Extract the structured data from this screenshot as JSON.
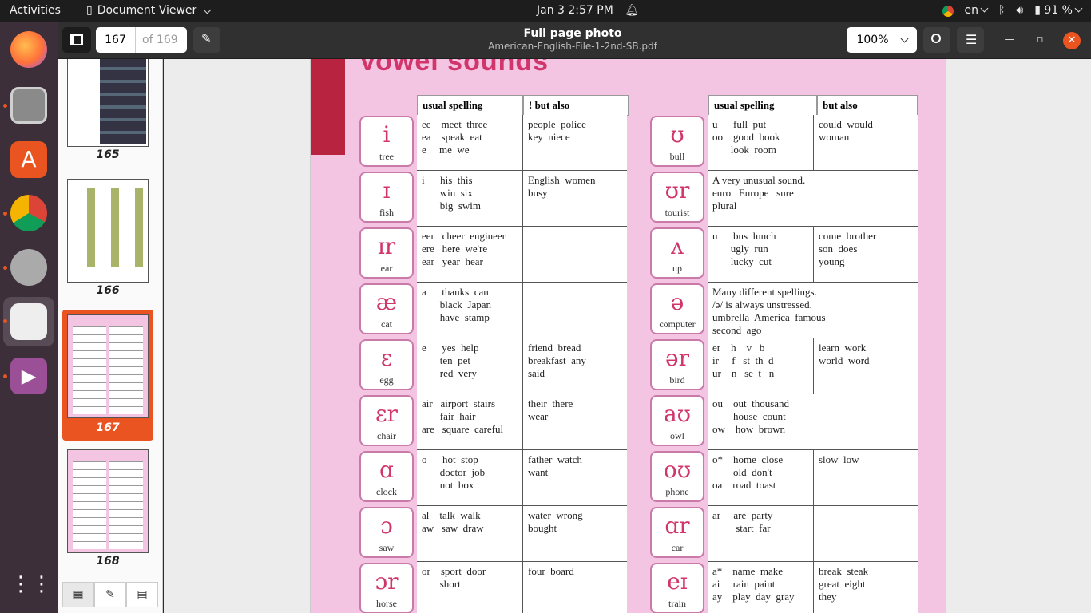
{
  "topbar": {
    "activities": "Activities",
    "app_name": "Document Viewer",
    "datetime": "Jan 3  2:57 PM",
    "lang": "en",
    "battery": "91 %"
  },
  "header": {
    "page_current": "167",
    "page_of": "of 169",
    "title": "Full page photo",
    "subtitle": "American-English-File-1-2nd-SB.pdf",
    "zoom": "100%"
  },
  "sidebar": {
    "thumbs": [
      {
        "label": "165"
      },
      {
        "label": "166"
      },
      {
        "label": "167"
      },
      {
        "label": "168"
      }
    ]
  },
  "page": {
    "heading_fragment": "Vowel sounds",
    "left_headers": {
      "usual": "usual spelling",
      "also": "! but also"
    },
    "right_headers": {
      "usual": "usual spelling",
      "also": "but also"
    },
    "left_rows": [
      {
        "sym": "i",
        "word": "tree",
        "usual": "ee    meet  three\nea    speak  eat\ne     me  we",
        "also": "people  police\nkey  niece"
      },
      {
        "sym": "ɪ",
        "word": "fish",
        "usual": "i      his  this\n       win  six\n       big  swim",
        "also": "English  women\nbusy"
      },
      {
        "sym": "ɪr",
        "word": "ear",
        "usual": "eer   cheer  engineer\nere   here  we're\near   year  hear",
        "also": ""
      },
      {
        "sym": "æ",
        "word": "cat",
        "usual": "a      thanks  can\n       black  Japan\n       have  stamp",
        "also": ""
      },
      {
        "sym": "ɛ",
        "word": "egg",
        "usual": "e      yes  help\n       ten  pet\n       red  very",
        "also": "friend  bread\nbreakfast  any\nsaid"
      },
      {
        "sym": "ɛr",
        "word": "chair",
        "usual": "air   airport  stairs\n       fair  hair\nare   square  careful",
        "also": "their  there\nwear"
      },
      {
        "sym": "ɑ",
        "word": "clock",
        "usual": "o      hot  stop\n       doctor  job\n       not  box",
        "also": "father  watch\nwant"
      },
      {
        "sym": "ɔ",
        "word": "saw",
        "usual": "al    talk  walk\naw   saw  draw",
        "also": "water  wrong\nbought"
      },
      {
        "sym": "ɔr",
        "word": "horse",
        "usual": "or    sport  door\n       short",
        "also": "four  board"
      }
    ],
    "right_rows": [
      {
        "sym": "ʊ",
        "word": "bull",
        "usual": "u      full  put\noo    good  book\n       look  room",
        "also": "could  would\nwoman",
        "merged": ""
      },
      {
        "sym": "ʊr",
        "word": "tourist",
        "usual": "",
        "also": "",
        "merged": "A very unusual sound.\neuro   Europe   sure\nplural"
      },
      {
        "sym": "ʌ",
        "word": "up",
        "usual": "u      bus  lunch\n       ugly  run\n       lucky  cut",
        "also": "come  brother\nson  does\nyoung",
        "merged": ""
      },
      {
        "sym": "ə",
        "word": "computer",
        "usual": "",
        "also": "",
        "merged": "Many different spellings.\n/ə/ is always unstressed.\numbrella  America  famous\nsecond  ago"
      },
      {
        "sym": "ər",
        "word": "bird",
        "usual": "er    h    v   b\nir     f   st  th  d\nur    n   se  t   n",
        "also": "learn  work\nworld  word",
        "merged": ""
      },
      {
        "sym": "aʊ",
        "word": "owl",
        "usual": "",
        "also": "",
        "merged": "ou    out  thousand\n        house  count\now    how  brown"
      },
      {
        "sym": "oʊ",
        "word": "phone",
        "usual": "o*    home  close\n        old  don't\noa    road  toast",
        "also": "slow  low",
        "merged": ""
      },
      {
        "sym": "ɑr",
        "word": "car",
        "usual": "ar     are  party\n         start  far",
        "also": "",
        "merged": ""
      },
      {
        "sym": "eɪ",
        "word": "train",
        "usual": "a*    name  make\nai     rain  paint\nay    play  day  gray",
        "also": "break  steak\ngreat  eight\nthey",
        "merged": ""
      }
    ]
  },
  "sidebar_buttons": {
    "grid": "▦",
    "annot": "✎",
    "book": "▤"
  },
  "colors": {
    "accent": "#e95420",
    "page_pink": "#f3c5e2",
    "hl": "#c0356a"
  }
}
